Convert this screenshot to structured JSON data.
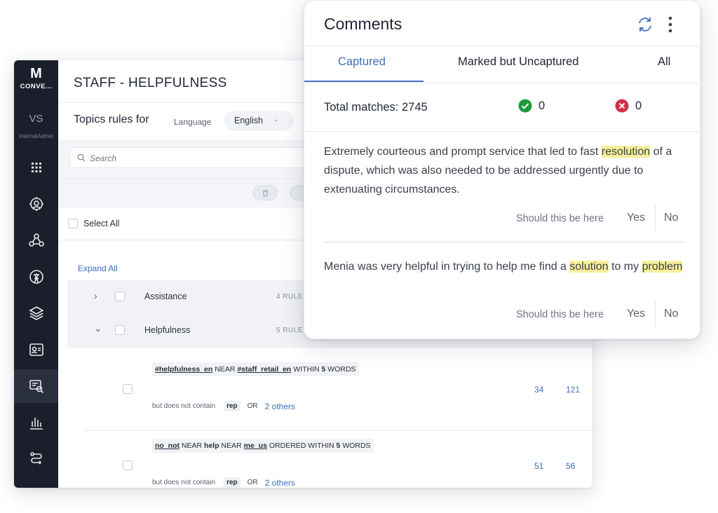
{
  "sidebar": {
    "logo_mark": "M",
    "logo_text": "CONVE...",
    "user_initials": "VS",
    "user_org": "InternalAdmin",
    "items": [
      {
        "icon": "grid-icon"
      },
      {
        "icon": "analytics-icon"
      },
      {
        "icon": "network-icon"
      },
      {
        "icon": "language-icon"
      },
      {
        "icon": "layers-icon"
      },
      {
        "icon": "contact-card-icon"
      },
      {
        "icon": "topic-search-icon",
        "active": true
      },
      {
        "icon": "bar-chart-icon"
      },
      {
        "icon": "flow-icon"
      }
    ]
  },
  "page": {
    "title": "STAFF - HELPFULNESS",
    "topics_rules_label": "Topics rules for",
    "language_label": "Language",
    "language_value": "English",
    "search_placeholder": "Search",
    "select_all": "Select All",
    "expand_all": "Expand All"
  },
  "topics": [
    {
      "name": "Assistance",
      "rules": "4 RULE",
      "expanded": false
    },
    {
      "name": "Helpfulness",
      "rules": "5 RULE",
      "expanded": true
    }
  ],
  "rules": [
    {
      "t1": "#helpfulness_en",
      "near": "NEAR",
      "t2": "#staff_retail_en",
      "within": "WITHIN",
      "n": "5",
      "words": "WORDS",
      "exclude_label": "but does not contain",
      "exclude_term": "rep",
      "or": "OR",
      "others": "2 others",
      "count1": "34",
      "count2": "121"
    },
    {
      "t1": "no_not",
      "near": "NEAR",
      "mid": "help",
      "near2": "NEAR",
      "t2": "me_us",
      "ordered": "ORDERED",
      "within": "WITHIN",
      "n": "5",
      "words": "WORDS",
      "exclude_label": "but does not contain",
      "exclude_term": "rep",
      "or": "OR",
      "others": "2 others",
      "count1": "51",
      "count2": "56"
    }
  ],
  "comments": {
    "title": "Comments",
    "tabs": [
      "Captured",
      "Marked but Uncaptured",
      "All"
    ],
    "active_tab": 0,
    "total_label": "Total matches: 2745",
    "approved_count": "0",
    "rejected_count": "0",
    "items": [
      {
        "pre": "Extremely courteous and prompt service that led to fast ",
        "hl1": "resolution",
        "post": " of a dispute, which was also needed to be addressed urgently due to extenuating circumstances.",
        "question": "Should this be here",
        "yes": "Yes",
        "no": "No"
      },
      {
        "pre": "Menia was very helpful in trying to help me find a ",
        "hl1": "solution",
        "mid": " to my ",
        "hl2": "problem",
        "question": "Should this be here",
        "yes": "Yes",
        "no": "No"
      }
    ]
  },
  "colors": {
    "accent": "#3e6ebd",
    "sidebar_bg": "#1b1f2b",
    "highlight": "#f7f09a",
    "ok_green": "#1f9a3a",
    "reject_red": "#d0314a"
  }
}
